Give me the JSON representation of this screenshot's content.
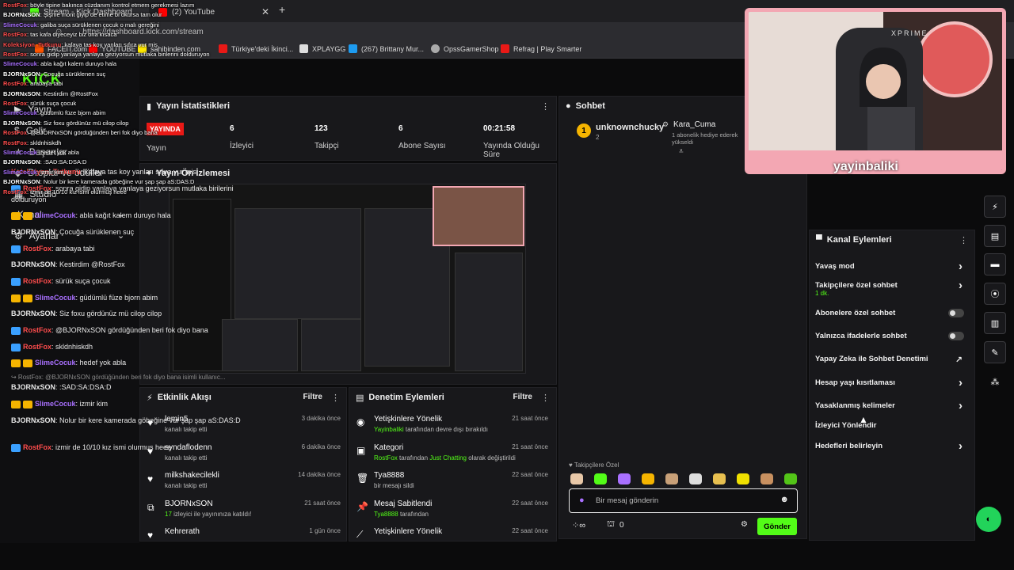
{
  "browser": {
    "tabs": [
      {
        "label": "Stream - Kick Dashboard"
      },
      {
        "label": "(2) YouTube"
      }
    ],
    "url": "https://dashboard.kick.com/stream",
    "bookmarks": [
      {
        "label": "FACEIT.com",
        "color": "#ff5500"
      },
      {
        "label": "YOUTUBE",
        "color": "#ff0000"
      },
      {
        "label": "sahibinden.com",
        "color": "#ffe800"
      },
      {
        "label": "Türkiye'deki İkinci...",
        "color": "#e91916"
      },
      {
        "label": "XPLAYGG",
        "color": "#dddddd"
      },
      {
        "label": "(267) Brittany Mur...",
        "color": "#1d9bf0"
      },
      {
        "label": "OpssGamerShop",
        "color": "#aaaaaa"
      },
      {
        "label": "Refrag | Play Smarter",
        "color": "#e91916"
      }
    ]
  },
  "logo": "KICK",
  "sidenav": {
    "items": [
      {
        "label": "Yayın"
      },
      {
        "label": "Gelir"
      },
      {
        "label": "Başarılar"
      },
      {
        "label": "Droplar ve ödüller"
      },
      {
        "label": "Studio"
      },
      {
        "label": "Kanal"
      },
      {
        "label": "Ayarlar"
      }
    ]
  },
  "overlay_chat": [
    {
      "user": "RostFox",
      "text": "böyle tipine bakınca cüzdanım kontrol etmem gerekmesi lazım",
      "color": "#ff4d4d"
    },
    {
      "user": "BJORNxSON",
      "text": "Şişme mont giyip de etime bi okursa tam olur",
      "color": "#ffffff"
    },
    {
      "user": "SlimeCocuk",
      "text": "galiba suça sürüklenen çocuk o malı gereğini",
      "color": "#a970ff"
    },
    {
      "user": "RostFox",
      "text": "tas kafa diyeceyiz biz ona kısaca",
      "color": "#ff4d4d"
    },
    {
      "user": "Koleksiyon_Tutkunu",
      "text": "kafaya tas koy yanları sıfıra vur mis",
      "color": "#ff4d4d"
    },
    {
      "user": "RostFox",
      "text": "sonra gidip yanlaya yanlaya geziyorsun mutlaka birilerini dolduruyon",
      "color": "#ff4d4d"
    },
    {
      "user": "SlimeCocuk",
      "text": "abla kağıt kalem duruyo hala",
      "color": "#a970ff"
    },
    {
      "user": "BJORNxSON",
      "text": "Çocuğa sürüklenen suç",
      "color": "#ffffff"
    },
    {
      "user": "RostFox",
      "text": "arabaya tabi",
      "color": "#ff4d4d"
    },
    {
      "user": "BJORNxSON",
      "text": "Kestirdim @RostFox",
      "color": "#ffffff"
    },
    {
      "user": "RostFox",
      "text": "sürük suça çocuk",
      "color": "#ff4d4d"
    },
    {
      "user": "SlimeCocuk",
      "text": "güdümlü füze bjorn abim",
      "color": "#a970ff"
    },
    {
      "user": "BJORNxSON",
      "text": "Siz foxu gördünüz mü cilop cilop",
      "color": "#ffffff"
    },
    {
      "user": "RostFox",
      "text": "@BJORNxSON gördüğünden beri fok diyo bana",
      "color": "#ff4d4d"
    },
    {
      "user": "RostFox",
      "text": "skldnhiskdh",
      "color": "#ff4d4d"
    },
    {
      "user": "SlimeCocuk",
      "text": "hedef yok abla",
      "color": "#a970ff"
    },
    {
      "user": "BJORNxSON",
      "text": ":SAD:SA:DSA:D",
      "color": "#ffffff"
    },
    {
      "user": "SlimeCocuk",
      "text": "izmir kim",
      "color": "#a970ff"
    },
    {
      "user": "BJORNxSON",
      "text": "Nolur bir kere kamerada göbeğine vur şap şap aS:DAS:D",
      "color": "#ffffff"
    },
    {
      "user": "RostFox",
      "text": "izmir de 10/10 kız ismi olurmuş heee",
      "color": "#ff4d4d"
    }
  ],
  "stats": {
    "title": "Yayın İstatistikleri",
    "live_badge": "YAYINDA",
    "status_label": "Yayın",
    "viewers_value": "6",
    "viewers_label": "İzleyici",
    "followers_value": "123",
    "followers_label": "Takipçi",
    "subs_value": "6",
    "subs_label": "Abone Sayısı",
    "duration_value": "00:21:58",
    "duration_label": "Yayında Olduğu Süre"
  },
  "preview": {
    "title": "Yayın Ön İzlemesi"
  },
  "feed": {
    "title": "Etkinlik Akışı",
    "filter": "Filtre",
    "items": [
      {
        "icon": "heart-icon",
        "glyph": "♥",
        "name": "lemin5",
        "sub": "kanalı takip etti",
        "time": "3 dakika önce"
      },
      {
        "icon": "heart-icon",
        "glyph": "♥",
        "name": "syndaflodenn",
        "sub": "kanalı takip etti",
        "time": "6 dakika önce"
      },
      {
        "icon": "heart-icon",
        "glyph": "♥",
        "name": "milkshakecilekli",
        "sub": "kanalı takip etti",
        "time": "14 dakika önce"
      },
      {
        "icon": "host-icon",
        "glyph": "⧉",
        "name": "BJORNxSON",
        "sub_accent": "17",
        "sub": "izleyici ile yayınınıza katıldı!",
        "time": "21 saat önce"
      },
      {
        "icon": "heart-icon",
        "glyph": "♥",
        "name": "Kehrerath",
        "sub": "",
        "time": "1 gün önce"
      }
    ]
  },
  "moderation": {
    "title": "Denetim Eylemleri",
    "filter": "Filtre",
    "items": [
      {
        "icon": "eye-icon",
        "glyph": "◉",
        "name": "Yetişkinlere Yönelik",
        "accent": "Yayinbaliki",
        "rest": "tarafından devre dışı bırakıldı",
        "time": "21 saat önce"
      },
      {
        "icon": "category-icon",
        "glyph": "▣",
        "name": "Kategori",
        "accent": "RostFox",
        "rest": "tarafından",
        "accent2": "Just Chatting",
        "rest2": "olarak değiştirildi",
        "time": "21 saat önce"
      },
      {
        "icon": "trash-icon",
        "glyph": "🗑",
        "name": "Tya8888",
        "accent": "",
        "rest": "bir mesajı sildi",
        "time": "22 saat önce"
      },
      {
        "icon": "pin-icon",
        "glyph": "📌",
        "name": "Mesaj Sabitlendi",
        "accent": "Tya8888",
        "rest": "tarafından",
        "time": "22 saat önce"
      },
      {
        "icon": "mature-icon",
        "glyph": "⟋",
        "name": "Yetişkinlere Yönelik",
        "accent": "",
        "rest": "",
        "time": "22 saat önce"
      }
    ]
  },
  "chat": {
    "title": "Sohbet",
    "top_gifter": "unknownchucky",
    "top_gifter_count": "2",
    "gifter2": "Kara_Cuma",
    "gifter2_sub": "1 abonelik hediye ederek yükseldi",
    "messages": [
      {
        "user": "Koleksiyon_Tutkunu",
        "text": "kafaya tas koy yanları sıfıra vur mis",
        "color": "c-red",
        "badges": []
      },
      {
        "user": "RostFox",
        "text": "sonra gidip yanlaya yanlaya geziyorsun mutlaka birilerini dolduruyon",
        "color": "c-red",
        "badges": [
          "blue"
        ]
      },
      {
        "user": "SlimeCocuk",
        "text": "abla kağıt kalem duruyo hala",
        "color": "c-purple",
        "badges": [
          "gold",
          "gold"
        ]
      },
      {
        "user": "BJORNxSON",
        "text": "Çocuğa sürüklenen suç",
        "color": "",
        "badges": []
      },
      {
        "user": "RostFox",
        "text": "arabaya tabi",
        "color": "c-red",
        "badges": [
          "blue"
        ]
      },
      {
        "user": "BJORNxSON",
        "text": "Kestirdim @RostFox",
        "color": "",
        "badges": []
      },
      {
        "user": "RostFox",
        "text": "sürük suça çocuk",
        "color": "c-red",
        "badges": [
          "blue"
        ]
      },
      {
        "user": "SlimeCocuk",
        "text": "güdümlü füze bjorn abim",
        "color": "c-purple",
        "badges": [
          "gold",
          "gold"
        ]
      },
      {
        "user": "BJORNxSON",
        "text": "Siz foxu gördünüz mü cilop cilop",
        "color": "",
        "badges": []
      },
      {
        "user": "RostFox",
        "text": "@BJORNxSON gördüğünden beri fok diyo bana",
        "color": "c-red",
        "badges": [
          "blue"
        ]
      },
      {
        "user": "RostFox",
        "text": "skldnhiskdh",
        "color": "c-red",
        "badges": [
          "blue"
        ]
      },
      {
        "user": "SlimeCocuk",
        "text": "hedef yok abla",
        "color": "c-purple",
        "badges": [
          "gold",
          "gold"
        ]
      }
    ],
    "reply_preview": "↪ RostFox: @BJORNxSON gördüğünden beri fok diyo bana isimli kullanıc...",
    "messages2": [
      {
        "user": "BJORNxSON",
        "text": ":SAD:SA:DSA:D",
        "color": "",
        "badges": []
      },
      {
        "user": "SlimeCocuk",
        "text": "izmir kim",
        "color": "c-purple",
        "badges": [
          "gold",
          "gold"
        ]
      },
      {
        "user": "BJORNxSON",
        "text": "Nolur bir kere kamerada göbeğine vur şap şap aS:DAS:D",
        "color": "",
        "badges": []
      },
      {
        "user": "RostFox",
        "text": "izmir de 10/10 kız ismi olurmuş heee",
        "color": "c-red",
        "badges": [
          "blue"
        ]
      }
    ],
    "emote_label": "Takipçilere Özel",
    "input_placeholder": "Bir mesaj gönderin",
    "kicks_count": "0",
    "send_label": "Gönder"
  },
  "actions": {
    "title": "Kanal Eylemleri",
    "items": [
      {
        "label": "Yavaş mod",
        "control": "arrow"
      },
      {
        "label": "Takipçilere özel sohbet",
        "sub": "1 dk.",
        "control": "arrow"
      },
      {
        "label": "Abonelere özel sohbet",
        "control": "toggle"
      },
      {
        "label": "Yalnızca ifadelerle sohbet",
        "control": "toggle"
      },
      {
        "label": "Yapay Zeka ile Sohbet Denetimi",
        "control": "external"
      },
      {
        "label": "Hesap yaşı kısıtlaması",
        "control": "arrow"
      },
      {
        "label": "Yasaklanmış kelimeler",
        "control": "arrow"
      },
      {
        "label": "İzleyici Yönlendir",
        "control": "none"
      },
      {
        "label": "Hedefleri belirleyin",
        "control": "arrow"
      }
    ]
  },
  "webcam": {
    "overlay_text": "yayinbaliki",
    "chair_brand": "XPRIME"
  },
  "colors": {
    "accent": "#53fc18",
    "live": "#e91916",
    "panel": "#18181b"
  }
}
